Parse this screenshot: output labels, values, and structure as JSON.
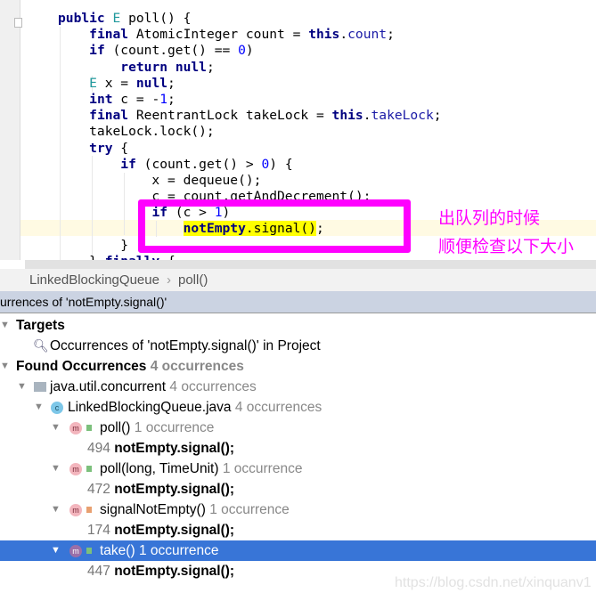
{
  "editor": {
    "lines": [
      [
        {
          "t": "public",
          "c": "kw"
        },
        {
          "t": " "
        },
        {
          "t": "E",
          "c": "ty"
        },
        {
          "t": " poll() {"
        }
      ],
      [
        {
          "t": "    "
        },
        {
          "t": "final",
          "c": "kw"
        },
        {
          "t": " AtomicInteger count = "
        },
        {
          "t": "this",
          "c": "kw"
        },
        {
          "t": "."
        },
        {
          "t": "count",
          "c": "fld"
        },
        {
          "t": ";"
        }
      ],
      [
        {
          "t": "    "
        },
        {
          "t": "if",
          "c": "kw"
        },
        {
          "t": " (count.get() == "
        },
        {
          "t": "0",
          "c": "num"
        },
        {
          "t": ")"
        }
      ],
      [
        {
          "t": "        "
        },
        {
          "t": "return",
          "c": "kw"
        },
        {
          "t": " "
        },
        {
          "t": "null",
          "c": "kw"
        },
        {
          "t": ";"
        }
      ],
      [
        {
          "t": "    "
        },
        {
          "t": "E",
          "c": "ty"
        },
        {
          "t": " x = "
        },
        {
          "t": "null",
          "c": "kw"
        },
        {
          "t": ";"
        }
      ],
      [
        {
          "t": "    "
        },
        {
          "t": "int",
          "c": "kw"
        },
        {
          "t": " c = -"
        },
        {
          "t": "1",
          "c": "num"
        },
        {
          "t": ";"
        }
      ],
      [
        {
          "t": "    "
        },
        {
          "t": "final",
          "c": "kw"
        },
        {
          "t": " ReentrantLock takeLock = "
        },
        {
          "t": "this",
          "c": "kw"
        },
        {
          "t": "."
        },
        {
          "t": "takeLock",
          "c": "fld"
        },
        {
          "t": ";"
        }
      ],
      [
        {
          "t": "    takeLock.lock();"
        }
      ],
      [
        {
          "t": "    "
        },
        {
          "t": "try",
          "c": "kw"
        },
        {
          "t": " {"
        }
      ],
      [
        {
          "t": "        "
        },
        {
          "t": "if",
          "c": "kw"
        },
        {
          "t": " (count.get() > "
        },
        {
          "t": "0",
          "c": "num"
        },
        {
          "t": ") {"
        }
      ],
      [
        {
          "t": "            x = dequeue();"
        }
      ],
      [
        {
          "t": "            c = count.getAndDecrement();"
        }
      ],
      [
        {
          "t": "            "
        },
        {
          "t": "if",
          "c": "kw"
        },
        {
          "t": " (c > "
        },
        {
          "t": "1",
          "c": "num"
        },
        {
          "t": ")"
        }
      ],
      [
        {
          "t": "                "
        },
        {
          "t": "notEmpty",
          "c": "kw hl"
        },
        {
          "t": ".signal()",
          "c": "hl"
        },
        {
          "t": ";"
        }
      ],
      [
        {
          "t": "        }"
        }
      ],
      [
        {
          "t": "    } "
        },
        {
          "t": "finally",
          "c": "kw"
        },
        {
          "t": " {"
        }
      ]
    ]
  },
  "annotation": {
    "line1": "出队列的时候",
    "line2": "顺便检查以下大小",
    "color": "#ff00ff"
  },
  "breadcrumb": {
    "items": [
      "LinkedBlockingQueue",
      "poll()"
    ],
    "separator": "›"
  },
  "find_panel": {
    "title": "urrences of 'notEmpty.signal()'",
    "targets_label": "Targets",
    "target_item": "Occurrences of 'notEmpty.signal()' in Project",
    "found_label": "Found Occurrences",
    "found_count": "4 occurrences",
    "package": {
      "name": "java.util.concurrent",
      "count": "4 occurrences"
    },
    "file": {
      "name": "LinkedBlockingQueue.java",
      "count": "4 occurrences",
      "icon_letter": "c"
    },
    "methods": [
      {
        "name": "poll()",
        "count": "1 occurrence",
        "line": "494",
        "code": "notEmpty.signal();",
        "visibility": "public",
        "selected": false
      },
      {
        "name": "poll(long, TimeUnit)",
        "count": "1 occurrence",
        "line": "472",
        "code": "notEmpty.signal();",
        "visibility": "public",
        "selected": false
      },
      {
        "name": "signalNotEmpty()",
        "count": "1 occurrence",
        "line": "174",
        "code": "notEmpty.signal();",
        "visibility": "private",
        "selected": false
      },
      {
        "name": "take()",
        "count": "1 occurrence",
        "line": "447",
        "code": "notEmpty.signal();",
        "visibility": "public",
        "selected": true
      }
    ],
    "method_icon_letter": "m",
    "selection_color": "#3875d7"
  },
  "watermark": "https://blog.csdn.net/xinquanv1"
}
